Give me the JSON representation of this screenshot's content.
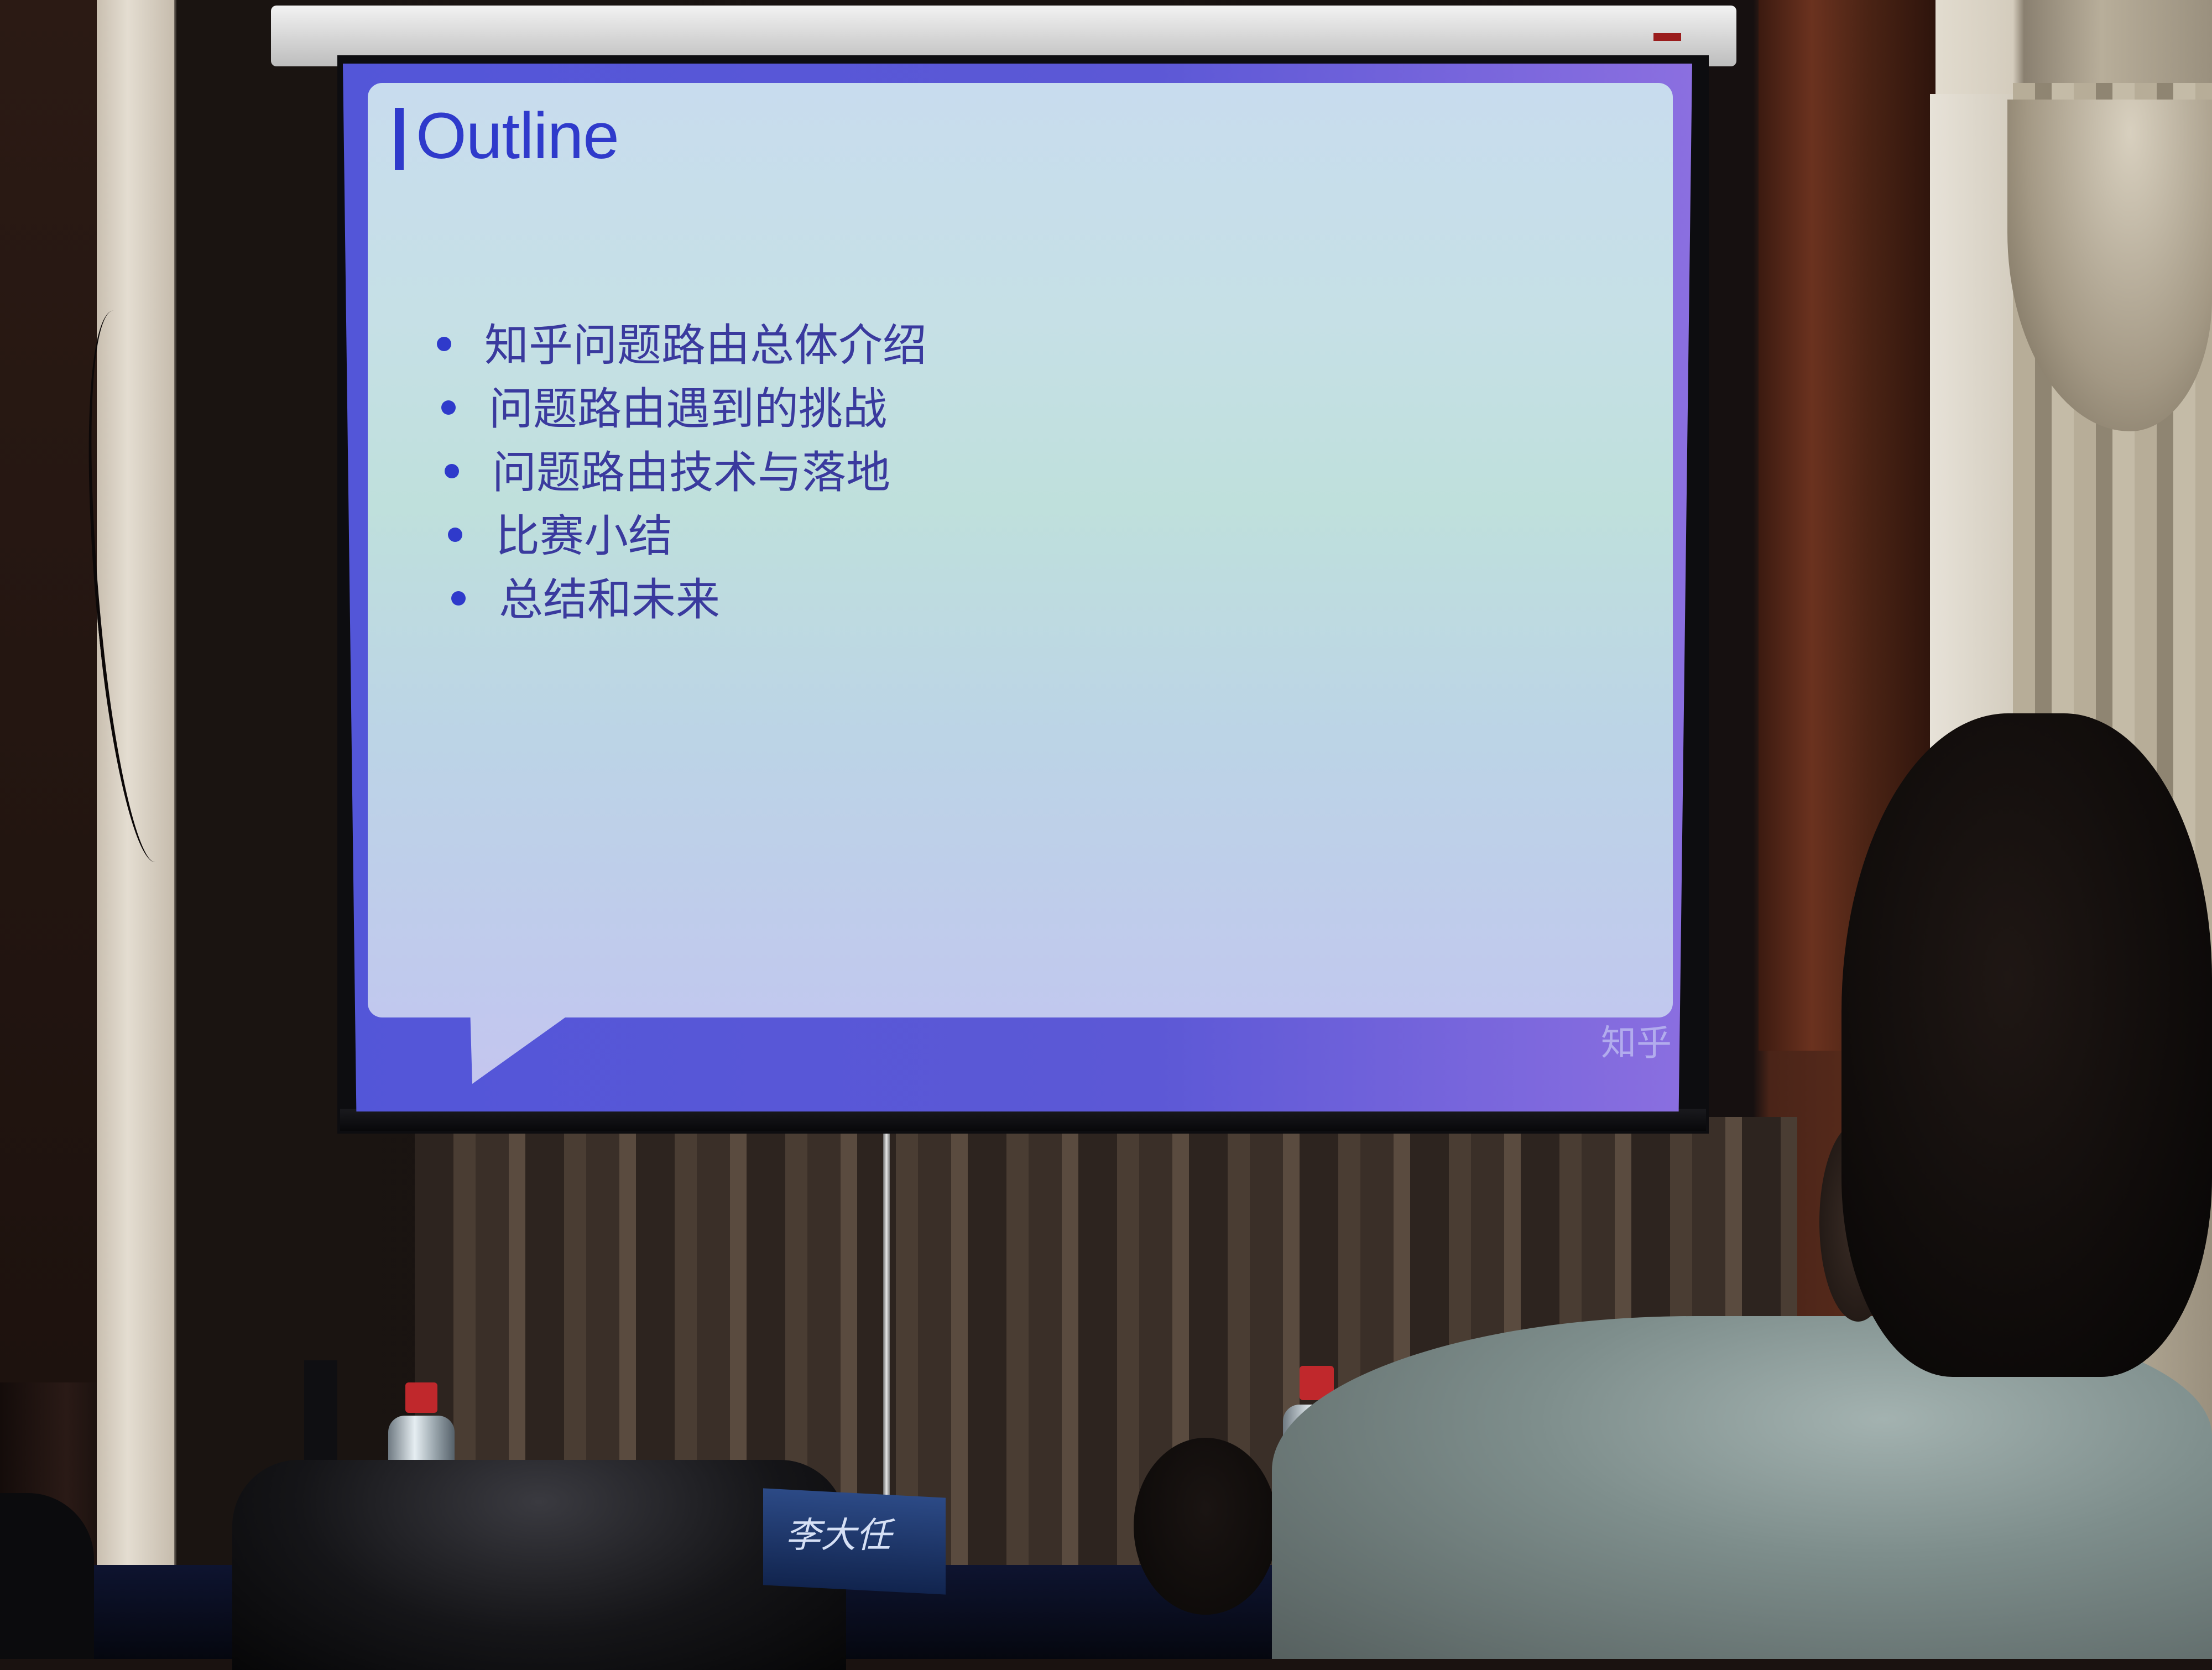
{
  "slide": {
    "title": "Outline",
    "items": [
      "知乎问题路由总体介绍",
      "问题路由遇到的挑战",
      "问题路由技术与落地",
      "比赛小结",
      "总结和未来"
    ],
    "logo_text": "知乎",
    "accent_color": "#2f3acb",
    "frame_color": "#5c58d6"
  },
  "nameplate": {
    "text": "李大任"
  }
}
